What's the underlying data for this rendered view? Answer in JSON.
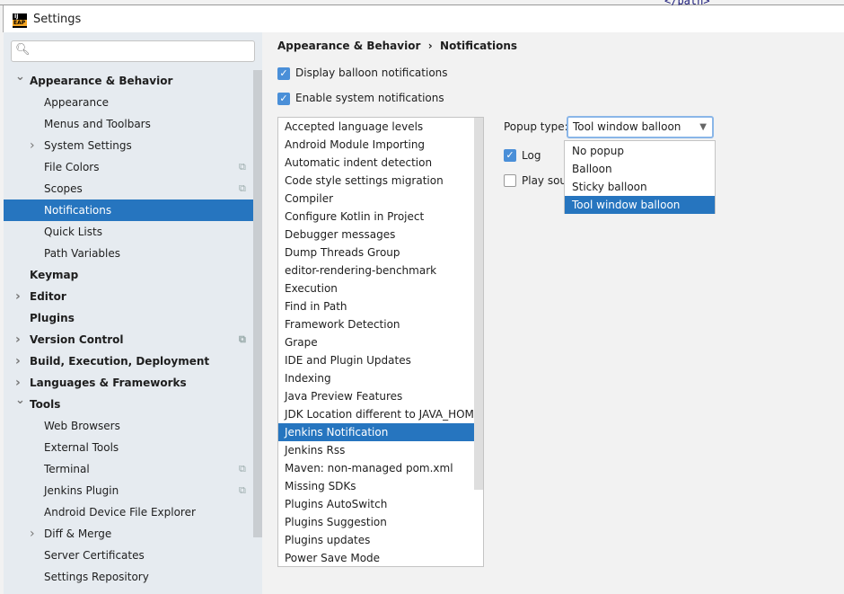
{
  "background_code": "</path>",
  "window": {
    "title": "Settings",
    "logo_top": "IJ",
    "logo_bottom": "EAP"
  },
  "search": {
    "placeholder": "",
    "icon": "search-icon"
  },
  "sidebar": {
    "items": [
      {
        "label": "Appearance & Behavior",
        "level": 0,
        "bold": true,
        "expand": "expanded"
      },
      {
        "label": "Appearance",
        "level": 1
      },
      {
        "label": "Menus and Toolbars",
        "level": 1
      },
      {
        "label": "System Settings",
        "level": 1,
        "expand": "collapsed"
      },
      {
        "label": "File Colors",
        "level": 1,
        "project_icon": true
      },
      {
        "label": "Scopes",
        "level": 1,
        "project_icon": true
      },
      {
        "label": "Notifications",
        "level": 1,
        "selected": true
      },
      {
        "label": "Quick Lists",
        "level": 1
      },
      {
        "label": "Path Variables",
        "level": 1
      },
      {
        "label": "Keymap",
        "level": 0,
        "bold": true
      },
      {
        "label": "Editor",
        "level": 0,
        "bold": true,
        "expand": "collapsed"
      },
      {
        "label": "Plugins",
        "level": 0,
        "bold": true
      },
      {
        "label": "Version Control",
        "level": 0,
        "bold": true,
        "expand": "collapsed",
        "project_icon": true
      },
      {
        "label": "Build, Execution, Deployment",
        "level": 0,
        "bold": true,
        "expand": "collapsed"
      },
      {
        "label": "Languages & Frameworks",
        "level": 0,
        "bold": true,
        "expand": "collapsed"
      },
      {
        "label": "Tools",
        "level": 0,
        "bold": true,
        "expand": "expanded"
      },
      {
        "label": "Web Browsers",
        "level": 1
      },
      {
        "label": "External Tools",
        "level": 1
      },
      {
        "label": "Terminal",
        "level": 1,
        "project_icon": true
      },
      {
        "label": "Jenkins Plugin",
        "level": 1,
        "project_icon": true
      },
      {
        "label": "Android Device File Explorer",
        "level": 1
      },
      {
        "label": "Diff & Merge",
        "level": 1,
        "expand": "collapsed"
      },
      {
        "label": "Server Certificates",
        "level": 1
      },
      {
        "label": "Settings Repository",
        "level": 1
      }
    ]
  },
  "breadcrumb": {
    "parent": "Appearance & Behavior",
    "separator": "›",
    "current": "Notifications"
  },
  "options": {
    "display_balloon": {
      "label": "Display balloon notifications",
      "checked": true
    },
    "system_notifications": {
      "label": "Enable system notifications",
      "checked": true
    }
  },
  "groups": {
    "selected": "Jenkins Notification",
    "items": [
      "Accepted language levels",
      "Android Module Importing",
      "Automatic indent detection",
      "Code style settings migration",
      "Compiler",
      "Configure Kotlin in Project",
      "Debugger messages",
      "Dump Threads Group",
      "editor-rendering-benchmark",
      "Execution",
      "Find in Path",
      "Framework Detection",
      "Grape",
      "IDE and Plugin Updates",
      "Indexing",
      "Java Preview Features",
      "JDK Location different to JAVA_HOME",
      "Jenkins Notification",
      "Jenkins Rss",
      "Maven: non-managed pom.xml",
      "Missing SDKs",
      "Plugins AutoSwitch",
      "Plugins Suggestion",
      "Plugins updates",
      "Power Save Mode"
    ]
  },
  "details": {
    "popup_label": "Popup type:",
    "popup_value": "Tool window balloon",
    "popup_options": [
      "No popup",
      "Balloon",
      "Sticky balloon",
      "Tool window balloon"
    ],
    "log": {
      "label": "Log",
      "checked": true
    },
    "play_sound": {
      "label": "Play sound",
      "checked": false
    }
  },
  "colors": {
    "accent": "#2675bf",
    "checkbox": "#4a8fd8",
    "sidebar_bg": "#e6ebf0",
    "panel_bg": "#f2f2f2"
  }
}
